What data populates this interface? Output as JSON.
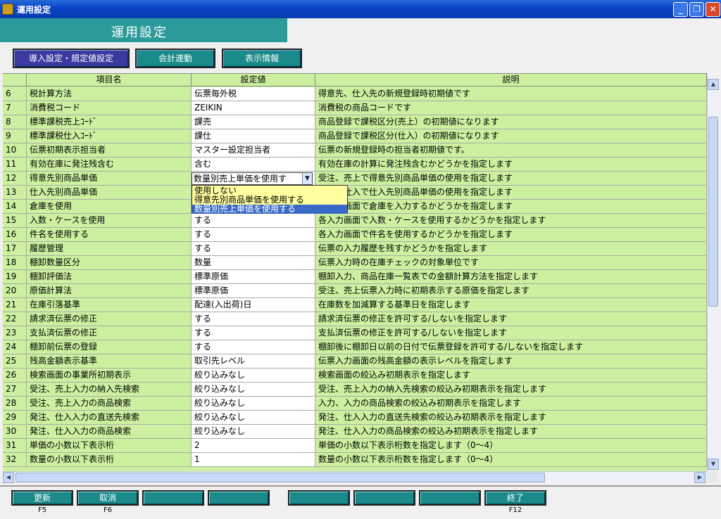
{
  "window": {
    "title": "運用設定"
  },
  "header": {
    "page_title": "運用設定"
  },
  "tabs": [
    {
      "label": "導入設定・規定値設定",
      "active": true
    },
    {
      "label": "会計連動",
      "active": false
    },
    {
      "label": "表示情報",
      "active": false
    }
  ],
  "grid": {
    "columns": [
      "",
      "項目名",
      "設定値",
      "説明"
    ],
    "rows": [
      {
        "num": "6",
        "name": "税計算方法",
        "value": "伝票毎外税",
        "desc": "得意先、仕入先の新規登録時初期値です"
      },
      {
        "num": "7",
        "name": "消費税コード",
        "value": "ZEIKIN",
        "desc": "消費税の商品コードです"
      },
      {
        "num": "8",
        "name": "標準課税売上ｺｰﾄﾞ",
        "value": "課売",
        "desc": "商品登録で課税区分(売上）の初期値になります"
      },
      {
        "num": "9",
        "name": "標準課税仕入ｺｰﾄﾞ",
        "value": "課仕",
        "desc": "商品登録で課税区分(仕入）の初期値になります"
      },
      {
        "num": "10",
        "name": "伝票初期表示担当者",
        "value": "マスター設定担当者",
        "desc": "伝票の新規登録時の担当者初期値です。"
      },
      {
        "num": "11",
        "name": "有効在庫に発注残含む",
        "value": "含む",
        "desc": "有効在庫の計算に発注残含むかどうかを指定します"
      },
      {
        "num": "12",
        "name": "得意先別商品単価",
        "value": "",
        "desc": "受注、売上で得意先別商品単価の使用を指定します"
      },
      {
        "num": "13",
        "name": "仕入先別商品単価",
        "value": "",
        "desc": "発注、仕入で仕入先別商品単価の使用を指定します"
      },
      {
        "num": "14",
        "name": "倉庫を使用",
        "value": "",
        "desc": "各入力画面で倉庫を入力するかどうかを指定します"
      },
      {
        "num": "15",
        "name": "入数・ケースを使用",
        "value": "する",
        "desc": "各入力画面で入数・ケースを使用するかどうかを指定します"
      },
      {
        "num": "16",
        "name": "件名を使用する",
        "value": "する",
        "desc": "各入力画面で件名を使用するかどうかを指定します"
      },
      {
        "num": "17",
        "name": "履歴管理",
        "value": "する",
        "desc": "伝票の入力履歴を残すかどうかを指定します"
      },
      {
        "num": "18",
        "name": "棚卸数量区分",
        "value": "数量",
        "desc": "伝票入力時の在庫チェックの対象単位です"
      },
      {
        "num": "19",
        "name": "棚卸評価法",
        "value": "標準原価",
        "desc": "棚卸入力、商品在庫一覧表での金額計算方法を指定します"
      },
      {
        "num": "20",
        "name": "原価計算法",
        "value": "標準原価",
        "desc": "受注、売上伝票入力時に初期表示する原価を指定します"
      },
      {
        "num": "21",
        "name": "在庫引落基準",
        "value": "配達(入出荷)日",
        "desc": "在庫数を加減算する基準日を指定します"
      },
      {
        "num": "22",
        "name": "請求済伝票の修正",
        "value": "する",
        "desc": "請求済伝票の修正を許可する/しないを指定します"
      },
      {
        "num": "23",
        "name": "支払済伝票の修正",
        "value": "する",
        "desc": "支払済伝票の修正を許可する/しないを指定します"
      },
      {
        "num": "24",
        "name": "棚卸前伝票の登録",
        "value": "する",
        "desc": "棚卸後に棚卸日以前の日付で伝票登録を許可する/しないを指定します"
      },
      {
        "num": "25",
        "name": "残高金額表示基準",
        "value": "取引先レベル",
        "desc": "伝票入力画面の残高金額の表示レベルを指定します"
      },
      {
        "num": "26",
        "name": "検索画面の事業所初期表示",
        "value": "絞り込みなし",
        "desc": "検索画面の絞込み初期表示を指定します"
      },
      {
        "num": "27",
        "name": "受注、売上入力の納入先検索",
        "value": "絞り込みなし",
        "desc": "受注、売上入力の納入先検索の絞込み初期表示を指定します"
      },
      {
        "num": "28",
        "name": "受注、売上入力の商品検索",
        "value": "絞り込みなし",
        "desc": "入力、入力の商品検索の絞込み初期表示を指定します"
      },
      {
        "num": "29",
        "name": "発注、仕入入力の直送先検索",
        "value": "絞り込みなし",
        "desc": "発注、仕入入力の直送先検索の絞込み初期表示を指定します"
      },
      {
        "num": "30",
        "name": "発注、仕入入力の商品検索",
        "value": "絞り込みなし",
        "desc": "発注、仕入入力の商品検索の絞込み初期表示を指定します"
      },
      {
        "num": "31",
        "name": "単価の小数以下表示桁",
        "value": "2",
        "desc": "単価の小数以下表示桁数を指定します（0～4）"
      },
      {
        "num": "32",
        "name": "数量の小数以下表示桁",
        "value": "1",
        "desc": "数量の小数以下表示桁数を指定します（0～4）"
      }
    ]
  },
  "dropdown": {
    "value": "数量別売上単価を使用す",
    "options": [
      {
        "label": "使用しない",
        "selected": false
      },
      {
        "label": "得意先別商品単価を使用する",
        "selected": false
      },
      {
        "label": "数量別売上単価を使用する",
        "selected": true
      }
    ]
  },
  "footer": {
    "keys": [
      {
        "label": "更新",
        "hint": "F5"
      },
      {
        "label": "取消",
        "hint": "F6"
      },
      {
        "label": "",
        "hint": ""
      },
      {
        "label": "",
        "hint": ""
      },
      {
        "label": "",
        "hint": ""
      },
      {
        "label": "",
        "hint": ""
      },
      {
        "label": "",
        "hint": ""
      },
      {
        "label": "終了",
        "hint": "F12"
      }
    ]
  },
  "colors": {
    "header_band": "#2a9a9a",
    "grid_green": "#ccf0a0",
    "tab_active": "#3a3aa0",
    "tab_teal": "#1a8a8a",
    "dropdown_bg": "#ffffa0",
    "dropdown_selected": "#3a6ac8"
  }
}
